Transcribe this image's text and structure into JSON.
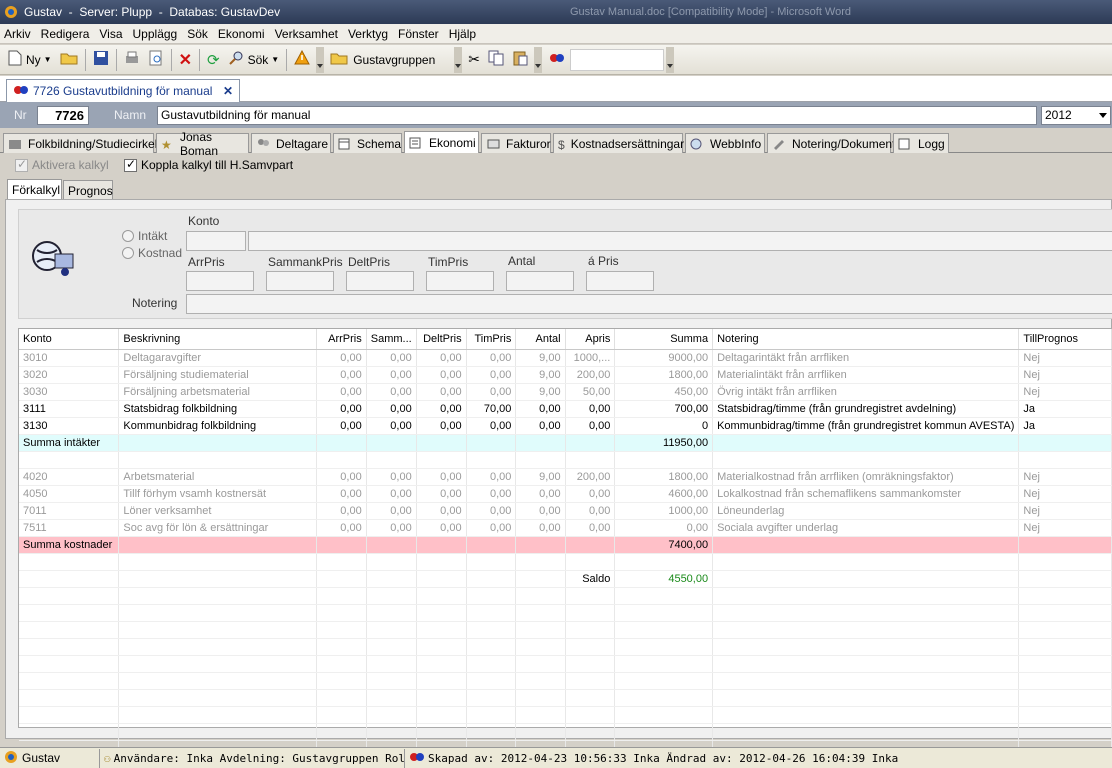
{
  "window": {
    "title": "Gustav  -  Server: Plupp  -  Databas: GustavDev",
    "ghost_title": "Gustav Manual.doc [Compatibility Mode] - Microsoft Word"
  },
  "menu": [
    "Arkiv",
    "Redigera",
    "Visa",
    "Upplägg",
    "Sök",
    "Ekonomi",
    "Verksamhet",
    "Verktyg",
    "Fönster",
    "Hjälp"
  ],
  "toolbar": {
    "new_label": "Ny",
    "search_label": "Sök",
    "group_label": "Gustavgruppen",
    "search_value": ""
  },
  "doc_tab": {
    "label": "7726  Gustavutbildning för manual"
  },
  "header": {
    "nr_label": "Nr",
    "nr_value": "7726",
    "name_label": "Namn",
    "name_value": "Gustavutbildning för manual",
    "year_value": "2012"
  },
  "tabs": [
    "Folkbildning/Studiecirkel",
    "Jonas Boman",
    "Deltagare",
    "Schema",
    "Ekonomi",
    "Fakturor",
    "Kostnadsersättningar",
    "WebbInfo",
    "Notering/Dokument",
    "Logg"
  ],
  "checks": {
    "aktivera": "Aktivera kalkyl",
    "koppla": "Koppla kalkyl till H.Samvpart"
  },
  "subtabs": [
    "Förkalkyl",
    "Prognos"
  ],
  "form": {
    "intakt": "Intäkt",
    "kostnad": "Kostnad",
    "konto": "Konto",
    "arrpris": "ArrPris",
    "sammankpris": "SammankPris",
    "deltpris": "DeltPris",
    "timpris": "TimPris",
    "antal": "Antal",
    "apris": "á Pris",
    "notering": "Notering"
  },
  "grid": {
    "columns": [
      "Konto",
      "Beskrivning",
      "ArrPris",
      "Samm...",
      "DeltPris",
      "TimPris",
      "Antal",
      "Apris",
      "Summa",
      "Notering",
      "TillPrognos"
    ],
    "income_rows": [
      {
        "konto": "3010",
        "besk": "Deltagaravgifter",
        "arr": "0,00",
        "samm": "0,00",
        "delt": "0,00",
        "tim": "0,00",
        "antal": "9,00",
        "apris": "1000,...",
        "summa": "9000,00",
        "not": "Deltagarintäkt från arrfliken",
        "till": "Nej",
        "grey": true
      },
      {
        "konto": "3020",
        "besk": "Försäljning studiematerial",
        "arr": "0,00",
        "samm": "0,00",
        "delt": "0,00",
        "tim": "0,00",
        "antal": "9,00",
        "apris": "200,00",
        "summa": "1800,00",
        "not": "Materialintäkt från arrfliken",
        "till": "Nej",
        "grey": true
      },
      {
        "konto": "3030",
        "besk": "Försäljning arbetsmaterial",
        "arr": "0,00",
        "samm": "0,00",
        "delt": "0,00",
        "tim": "0,00",
        "antal": "9,00",
        "apris": "50,00",
        "summa": "450,00",
        "not": "Övrig intäkt från arrfliken",
        "till": "Nej",
        "grey": true
      },
      {
        "konto": "3111",
        "besk": "Statsbidrag folkbildning",
        "arr": "0,00",
        "samm": "0,00",
        "delt": "0,00",
        "tim": "70,00",
        "antal": "0,00",
        "apris": "0,00",
        "summa": "700,00",
        "not": "Statsbidrag/timme (från grundregistret avdelning)",
        "till": "Ja",
        "grey": false
      },
      {
        "konto": "3130",
        "besk": "Kommunbidrag folkbildning",
        "arr": "0,00",
        "samm": "0,00",
        "delt": "0,00",
        "tim": "0,00",
        "antal": "0,00",
        "apris": "0,00",
        "summa": "0",
        "not": "Kommunbidrag/timme (från grundregistret kommun AVESTA)",
        "till": "Ja",
        "grey": false
      }
    ],
    "sum_income_label": "Summa intäkter",
    "sum_income_value": "11950,00",
    "cost_rows": [
      {
        "konto": "4020",
        "besk": "Arbetsmaterial",
        "arr": "0,00",
        "samm": "0,00",
        "delt": "0,00",
        "tim": "0,00",
        "antal": "9,00",
        "apris": "200,00",
        "summa": "1800,00",
        "not": "Materialkostnad från arrfliken (omräkningsfaktor)",
        "till": "Nej",
        "grey": true
      },
      {
        "konto": "4050",
        "besk": "Tillf förhym vsamh kostnersät",
        "arr": "0,00",
        "samm": "0,00",
        "delt": "0,00",
        "tim": "0,00",
        "antal": "0,00",
        "apris": "0,00",
        "summa": "4600,00",
        "not": "Lokalkostnad från schemaflikens sammankomster",
        "till": "Nej",
        "grey": true
      },
      {
        "konto": "7011",
        "besk": "Löner verksamhet",
        "arr": "0,00",
        "samm": "0,00",
        "delt": "0,00",
        "tim": "0,00",
        "antal": "0,00",
        "apris": "0,00",
        "summa": "1000,00",
        "not": "Löneunderlag",
        "till": "Nej",
        "grey": true
      },
      {
        "konto": "7511",
        "besk": "Soc avg för lön & ersättningar",
        "arr": "0,00",
        "samm": "0,00",
        "delt": "0,00",
        "tim": "0,00",
        "antal": "0,00",
        "apris": "0,00",
        "summa": "0,00",
        "not": "Sociala avgifter underlag",
        "till": "Nej",
        "grey": true
      }
    ],
    "sum_cost_label": "Summa kostnader",
    "sum_cost_value": "7400,00",
    "saldo_label": "Saldo",
    "saldo_value": "4550,00"
  },
  "status": {
    "app": "Gustav",
    "user": "Användare: Inka  Avdelning: Gustavgruppen  Roll: SAdb",
    "created": "Skapad av: 2012-04-23 10:56:33 Inka Ändrad av: 2012-04-26 16:04:39 Inka"
  },
  "colors": {
    "sum_income_bg": "#e0fcfc",
    "sum_cost_bg": "#ffc0c8",
    "saldo": "#1a8a1a",
    "title_bg": "#2c3a55"
  }
}
